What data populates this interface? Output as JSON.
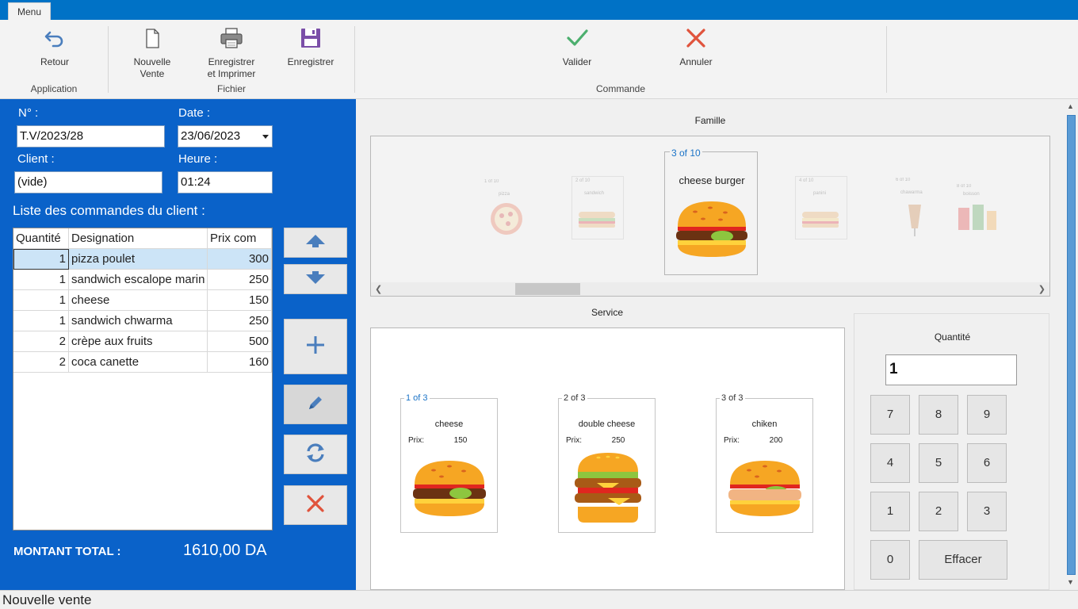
{
  "menu": {
    "tab_label": "Menu"
  },
  "ribbon": {
    "groups": {
      "application": "Application",
      "fichier": "Fichier",
      "commande": "Commande"
    },
    "buttons": {
      "retour": "Retour",
      "nouvelle_vente": [
        "Nouvelle",
        "Vente"
      ],
      "enregistrer_imprimer": [
        "Enregistrer",
        "et Imprimer"
      ],
      "enregistrer": "Enregistrer",
      "valider": "Valider",
      "annuler": "Annuler"
    }
  },
  "form": {
    "num_label": "N° :",
    "num_value": "T.V/2023/28",
    "date_label": "Date :",
    "date_value": "23/06/2023",
    "client_label": "Client :",
    "client_value": "(vide)",
    "heure_label": "Heure :",
    "heure_value": "01:24",
    "list_title": "Liste des commandes du client :"
  },
  "orders": {
    "columns": [
      "Quantité",
      "Designation",
      "Prix com"
    ],
    "rows": [
      {
        "qty": "1",
        "designation": "pizza poulet",
        "price": "300"
      },
      {
        "qty": "1",
        "designation": "sandwich escalope marin",
        "price": "250"
      },
      {
        "qty": "1",
        "designation": "cheese",
        "price": "150"
      },
      {
        "qty": "1",
        "designation": "sandwich chwarma",
        "price": "250"
      },
      {
        "qty": "2",
        "designation": "crèpe aux fruits",
        "price": "500"
      },
      {
        "qty": "2",
        "designation": "coca canette",
        "price": "160"
      }
    ],
    "selected_row": 0
  },
  "total": {
    "label": "MONTANT TOTAL :",
    "value": "1610,00 DA"
  },
  "famille": {
    "title": "Famille",
    "current": {
      "counter": "3 of 10",
      "name": "cheese burger"
    },
    "ghosts": [
      {
        "counter": "1 of 10",
        "name": "pizza"
      },
      {
        "counter": "2 of 10",
        "name": "sandwich"
      },
      {
        "counter": "4 of 10",
        "name": "panini"
      },
      {
        "counter": "6 of 10",
        "name": "chawarma"
      },
      {
        "counter": "8 of 10",
        "name": "boisson"
      }
    ]
  },
  "service": {
    "title": "Service",
    "price_label": "Prix:",
    "items": [
      {
        "counter": "1 of 3",
        "name": "cheese",
        "price": "150"
      },
      {
        "counter": "2 of 3",
        "name": "double cheese",
        "price": "250"
      },
      {
        "counter": "3 of 3",
        "name": "chiken",
        "price": "200"
      }
    ]
  },
  "keypad": {
    "title": "Quantité",
    "value": "1",
    "keys": [
      "7",
      "8",
      "9",
      "4",
      "5",
      "6",
      "1",
      "2",
      "3",
      "0"
    ],
    "clear_label": "Effacer"
  },
  "status": {
    "text": "Nouvelle vente"
  },
  "colors": {
    "accent": "#0072c6",
    "panel": "#0a62c9",
    "selected_row": "#cce4f7",
    "icon_blue": "#4a7ebd",
    "valider_green": "#4caf6e",
    "annuler_red": "#e0533c"
  }
}
